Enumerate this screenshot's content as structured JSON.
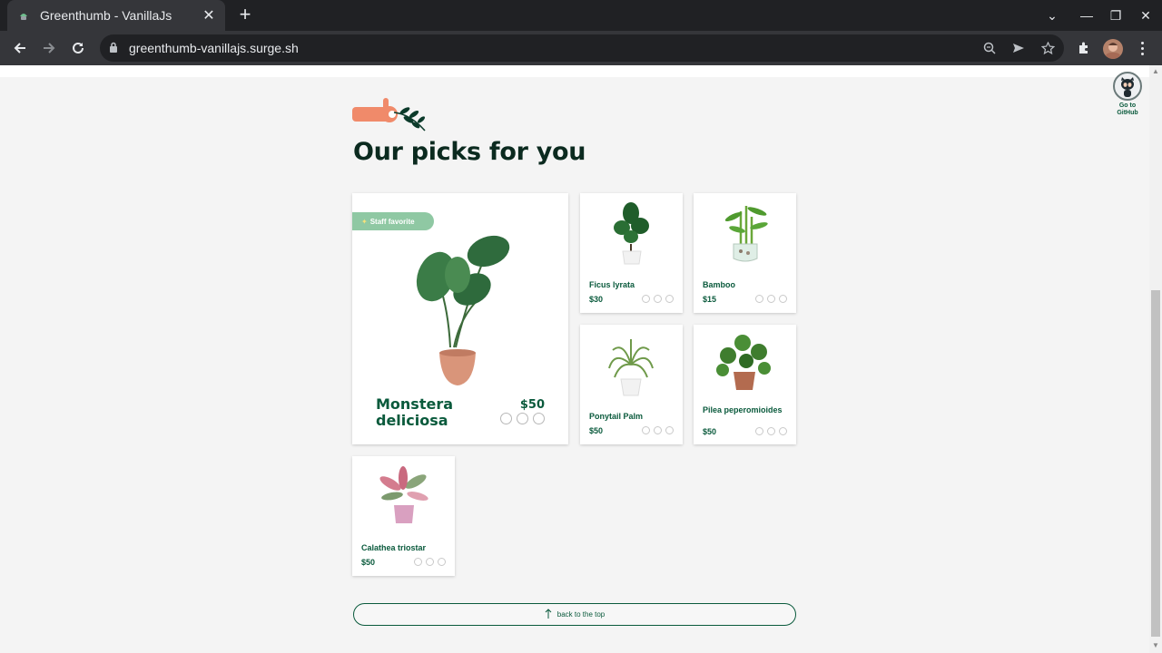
{
  "browser": {
    "tab_title": "Greenthumb - VanillaJs",
    "url": "greenthumb-vanillajs.surge.sh"
  },
  "github_link": {
    "label": "Go to GitHub"
  },
  "section": {
    "heading": "Our picks for you"
  },
  "featured": {
    "badge": "Staff favorite",
    "name": "Monstera deliciosa",
    "price": "$50"
  },
  "plants": [
    {
      "name": "Ficus lyrata",
      "price": "$30"
    },
    {
      "name": "Bamboo",
      "price": "$15"
    },
    {
      "name": "Ponytail Palm",
      "price": "$50"
    },
    {
      "name": "Pilea peperomioides",
      "price": "$50"
    },
    {
      "name": "Calathea triostar",
      "price": "$50"
    }
  ],
  "back_to_top": "back to the top",
  "colors": {
    "brand_green": "#0a5a3c",
    "badge_green": "#8fc8a3",
    "hand_coral": "#f08a6a"
  }
}
